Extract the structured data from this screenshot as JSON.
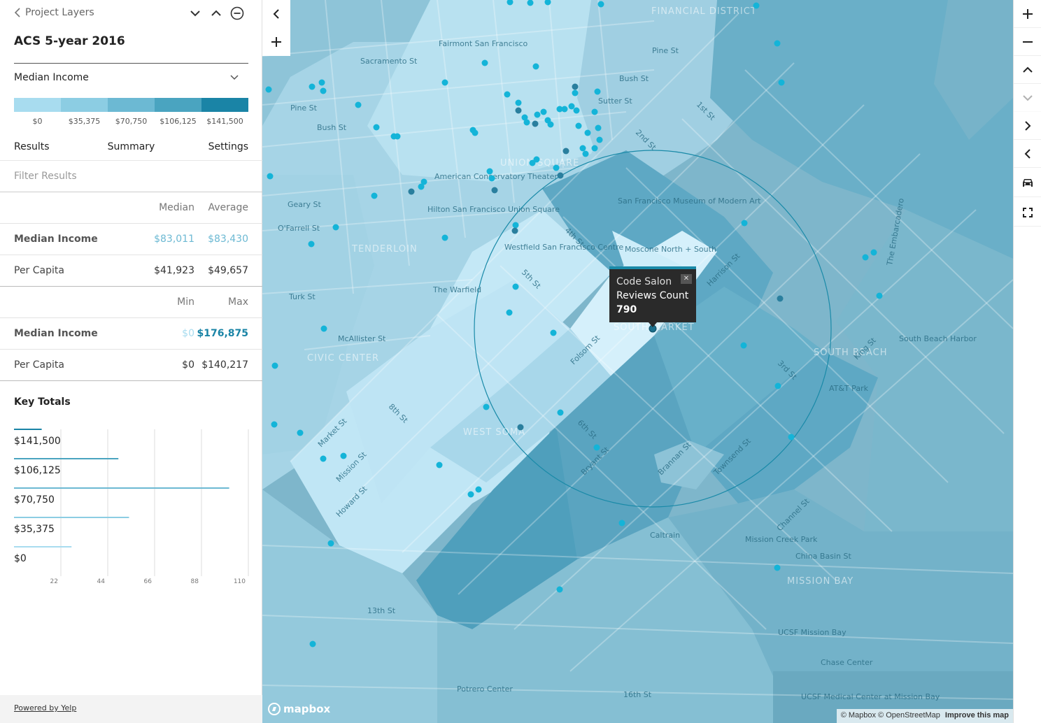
{
  "sidebar": {
    "breadcrumb": "Project Layers",
    "layer_title": "ACS 5-year 2016",
    "metric": "Median Income",
    "legend": {
      "colors": [
        "#a8dcef",
        "#8ccde3",
        "#6cb9d3",
        "#4aa4c0",
        "#1a84a6"
      ],
      "labels": [
        "$0",
        "$35,375",
        "$70,750",
        "$106,125",
        "$141,500"
      ]
    },
    "tabs": [
      {
        "label": "Results"
      },
      {
        "label": "Summary"
      },
      {
        "label": "Settings"
      }
    ],
    "filter_placeholder": "Filter Results",
    "stats_head_1": {
      "c1": "Median",
      "c2": "Average"
    },
    "stats_rows_1": [
      {
        "label": "Median Income",
        "c1": "$83,011",
        "c2": "$83,430"
      },
      {
        "label": "Per Capita",
        "c1": "$41,923",
        "c2": "$49,657"
      }
    ],
    "stats_head_2": {
      "c1": "Min",
      "c2": "Max"
    },
    "stats_rows_2": [
      {
        "label": "Median Income",
        "c1": "$0",
        "c2": "$176,875"
      },
      {
        "label": "Per Capita",
        "c1": "$0",
        "c2": "$140,217"
      }
    ],
    "key_totals_title": "Key Totals",
    "footer_link": "Powered by Yelp"
  },
  "chart_data": {
    "type": "bar",
    "orientation": "horizontal",
    "categories": [
      "$141,500",
      "$106,125",
      "$70,750",
      "$35,375",
      "$0"
    ],
    "values": [
      13,
      49,
      101,
      54,
      27
    ],
    "x_ticks": [
      "22",
      "44",
      "66",
      "88",
      "110"
    ],
    "xlim": [
      0,
      110
    ],
    "grid": true,
    "colors": [
      "#1a84a6",
      "#4aa4c0",
      "#6cb9d3",
      "#8ccde3",
      "#a8dcef"
    ]
  },
  "map": {
    "street_labels": {
      "tenderloin": "TENDERLOIN",
      "union_square": "UNION SQUARE",
      "financial": "FINANCIAL DISTRICT",
      "civic": "CIVIC CENTER",
      "west_soma": "WEST SOMA",
      "south_market": "SOUTH MARKET",
      "mission_bay": "MISSION BAY",
      "south_beach": "SOUTH BEACH",
      "sfmoma": "San Francisco Museum of Modern Art",
      "att_park": "AT&T Park",
      "ucsf": "UCSF Mission Bay",
      "market_st": "Market St",
      "mission_st": "Mission St",
      "howard_st": "Howard St",
      "folsom_st": "Folsom St",
      "bryant_st": "Bryant St",
      "harrison_st": "Harrison St",
      "brannan_st": "Brannan St",
      "townsend_st": "Townsend St",
      "king_st": "King St",
      "bush_st": "Bush St",
      "pine_st": "Pine St",
      "sutter_st": "Sutter St",
      "geary_st": "Geary St",
      "ofarrell_st": "O'Farrell St",
      "turk_st": "Turk St",
      "mcallister_st": "McAllister St",
      "sacramento_st": "Sacramento St",
      "th_13": "13th St",
      "th_16": "16th St",
      "channel_st": "Channel St",
      "china_basin": "China Basin St",
      "embarcadero": "The Embarcadero",
      "caltrain": "Caltrain",
      "th_5": "5th St",
      "th_4": "4th St",
      "th_6": "6th St",
      "th_8": "8th St",
      "nd_2": "2nd St",
      "rd_3": "3rd St",
      "st_1": "1st St",
      "chase": "Chase Center",
      "potrero": "Potrero Center",
      "westfield": "Westfield San Francisco Centre",
      "hilton": "Hilton San Francisco Union Square",
      "act": "American Conservatory Theater",
      "warfield": "The Warfield",
      "fairmont": "Fairmont San Francisco",
      "moscone": "Moscone North + South",
      "mission_creek": "Mission Creek Park",
      "sb_harbor": "South Beach Harbor",
      "ucsf_med": "UCSF Medical Center at Mission Bay"
    },
    "popup": {
      "name": "Code Salon",
      "metric": "Reviews Count",
      "value": "790"
    },
    "logo": "mapbox",
    "attribution": "© Mapbox © OpenStreetMap",
    "attribution_link": "Improve this map"
  }
}
